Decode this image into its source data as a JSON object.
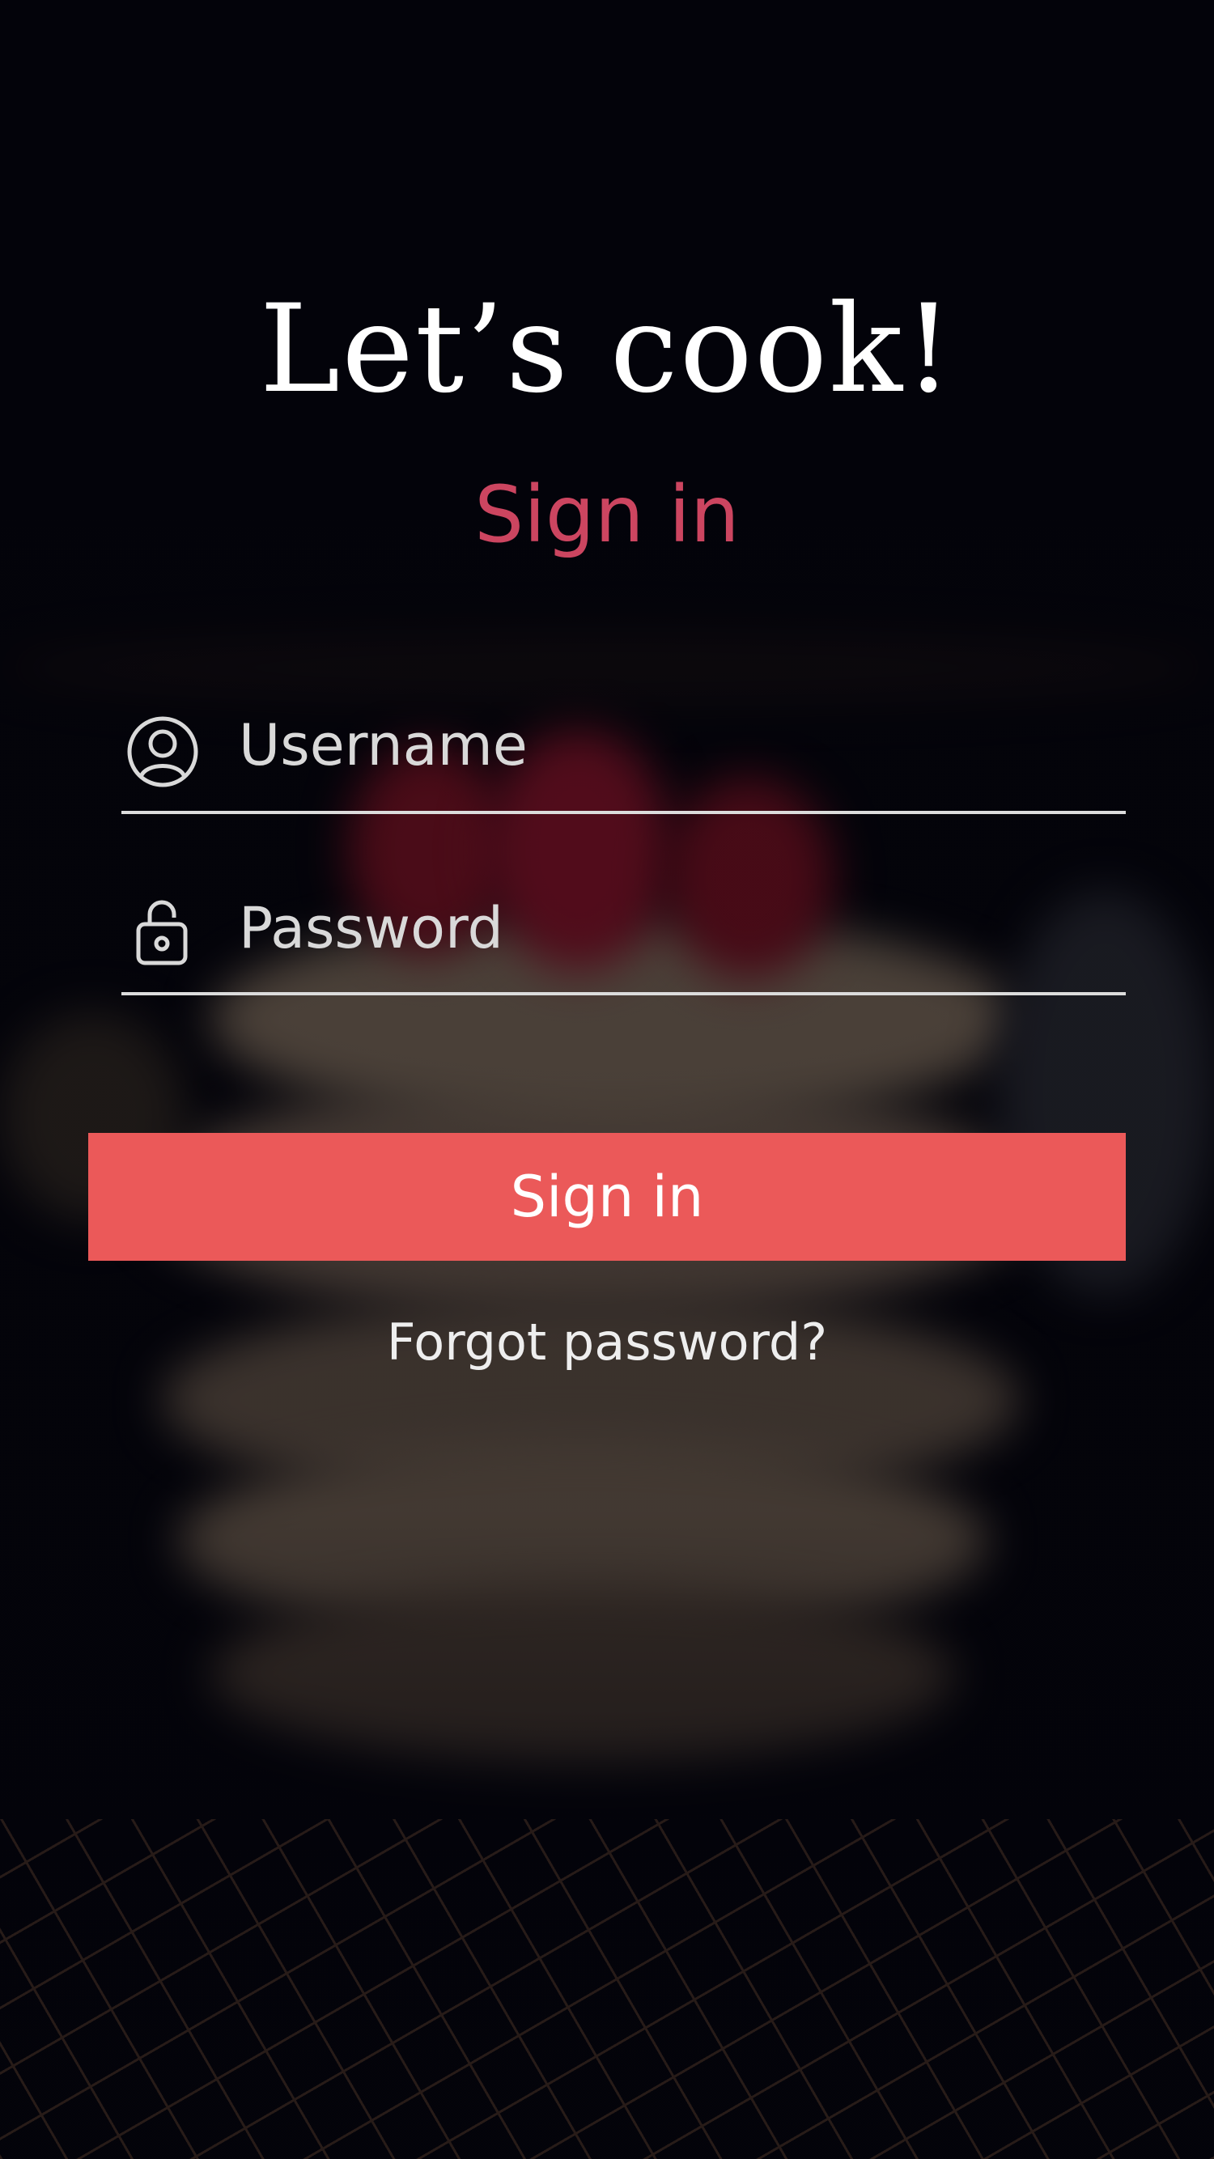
{
  "header": {
    "title": "Let’s cook!",
    "subtitle": "Sign in"
  },
  "form": {
    "username": {
      "placeholder": "Username",
      "icon": "user-circle-icon"
    },
    "password": {
      "placeholder": "Password",
      "icon": "lock-icon"
    },
    "submit_label": "Sign in",
    "forgot_label": "Forgot password?"
  },
  "colors": {
    "accent": "#eb5959",
    "subtitle": "#cc4560",
    "background": "#04040a"
  }
}
